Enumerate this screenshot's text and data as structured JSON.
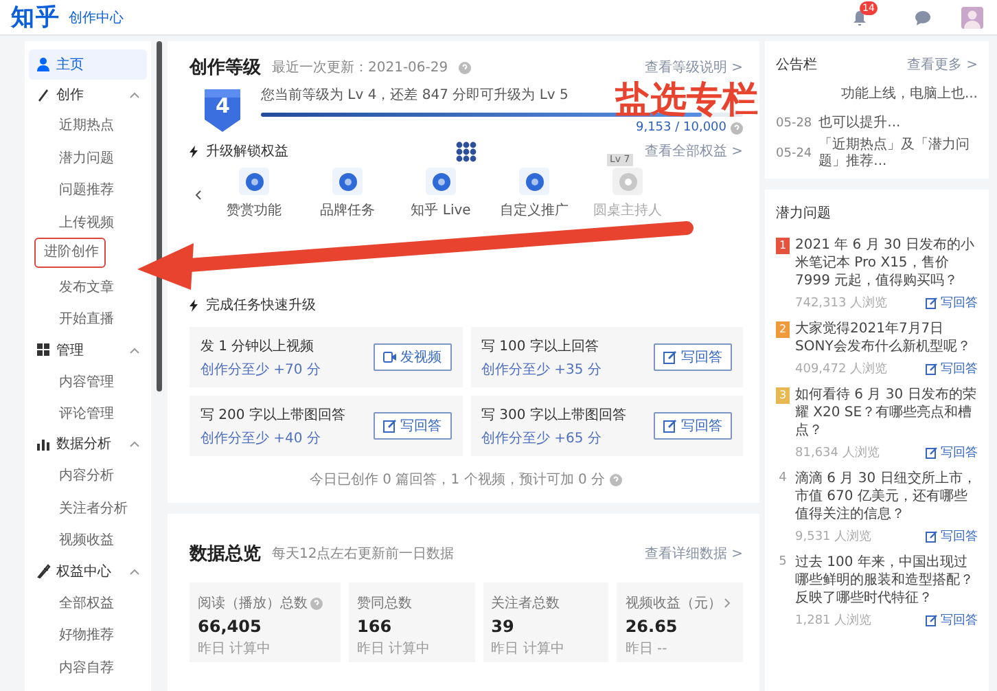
{
  "topbar": {
    "logo": "知乎",
    "subtitle": "创作中心",
    "notification_count": "14"
  },
  "sidebar": {
    "items": [
      {
        "label": "主页",
        "kind": "link",
        "selected": true
      },
      {
        "label": "创作",
        "kind": "section",
        "selected": false,
        "expanded": true,
        "children": [
          {
            "label": "近期热点",
            "selected": false,
            "circled": false
          },
          {
            "label": "潜力问题",
            "selected": false,
            "circled": false
          },
          {
            "label": "问题推荐",
            "selected": false,
            "circled": false
          },
          {
            "label": "上传视频",
            "selected": false,
            "circled": false
          },
          {
            "label": "进阶创作",
            "selected": false,
            "circled": true
          },
          {
            "label": "发布文章",
            "selected": false,
            "circled": false
          },
          {
            "label": "开始直播",
            "selected": false,
            "circled": false
          }
        ]
      },
      {
        "label": "管理",
        "kind": "section",
        "selected": false,
        "expanded": true,
        "children": [
          {
            "label": "内容管理",
            "selected": false,
            "circled": false
          },
          {
            "label": "评论管理",
            "selected": false,
            "circled": false
          }
        ]
      },
      {
        "label": "数据分析",
        "kind": "section",
        "selected": false,
        "expanded": true,
        "children": [
          {
            "label": "内容分析",
            "selected": false,
            "circled": false
          },
          {
            "label": "关注者分析",
            "selected": false,
            "circled": false
          },
          {
            "label": "视频收益",
            "selected": false,
            "circled": false
          }
        ]
      },
      {
        "label": "权益中心",
        "kind": "section",
        "selected": false,
        "expanded": true,
        "children": [
          {
            "label": "全部权益",
            "selected": false,
            "circled": false
          },
          {
            "label": "好物推荐",
            "selected": false,
            "circled": false
          },
          {
            "label": "内容自荐",
            "selected": false,
            "circled": false
          }
        ]
      }
    ]
  },
  "level_card": {
    "title": "创作等级",
    "updated": "最近一次更新：2021-06-29",
    "link": "查看等级说明 >",
    "badge": "4",
    "message": "您当前等级为 Lv 4，还差 847 分即可升级为 Lv 5",
    "level": 0.9153,
    "reading": "9,153 / 10,000",
    "benefits_title": "升级解锁权益",
    "benefits_link": "查看全部权益 >",
    "benefits": [
      {
        "label": "赞赏功能",
        "locked": false
      },
      {
        "label": "品牌任务",
        "locked": false
      },
      {
        "label": "知乎 Live",
        "locked": false
      },
      {
        "label": "自定义推广",
        "locked": false
      },
      {
        "label": "圆桌主持人",
        "locked": true,
        "tag": "Lv 7"
      }
    ],
    "tasks_title": "完成任务快速升级",
    "tasks": [
      {
        "title": "发 1 分钟以上视频",
        "reward": "创作分至少 +70 分",
        "action": "发视频",
        "kind": "video"
      },
      {
        "title": "写 100 字以上回答",
        "reward": "创作分至少 +35 分",
        "action": "写回答",
        "kind": "answer"
      },
      {
        "title": "写 200 字以上带图回答",
        "reward": "创作分至少 +40 分",
        "action": "写回答",
        "kind": "answer"
      },
      {
        "title": "写 300 字以上带图回答",
        "reward": "创作分至少 +65 分",
        "action": "写回答",
        "kind": "answer"
      }
    ],
    "summary": "今日已创作 0 篇回答，1 个视频，预计可加 0 分"
  },
  "data_card": {
    "title": "数据总览",
    "subtitle": "每天12点左右更新前一日数据",
    "link": "查看详细数据 >",
    "stats": [
      {
        "label": "阅读（播放）总数",
        "value": "66,405",
        "note": "昨日  计算中",
        "kind": "help"
      },
      {
        "label": "赞同总数",
        "value": "166",
        "note": "昨日  计算中",
        "kind": "plain"
      },
      {
        "label": "关注者总数",
        "value": "39",
        "note": "昨日  计算中",
        "kind": "plain"
      },
      {
        "label": "视频收益（元）",
        "value": "26.65",
        "note": "昨日  --",
        "kind": "link"
      }
    ]
  },
  "notice_board": {
    "title": "公告栏",
    "link": "查看更多 >",
    "items": [
      {
        "text": "功能上线，电脑上也..."
      },
      {
        "date": "05-28",
        "text": "也可以提升..."
      },
      {
        "date": "05-24",
        "text": "「近期热点」及「潜力问题」推荐..."
      }
    ]
  },
  "potential_questions": {
    "title": "潜力问题",
    "items": [
      {
        "rank": "1",
        "color": "#e5533f",
        "question": "2021 年 6 月 30 日发布的小米笔记本 Pro X15，售价 7999 元起，值得购买吗？",
        "views": "742,313 人浏览",
        "action": "写回答"
      },
      {
        "rank": "2",
        "color": "#f09a3c",
        "question": "大家觉得2021年7月7日SONY会发布什么新机型呢？",
        "views": "409,472 人浏览",
        "action": "写回答"
      },
      {
        "rank": "3",
        "color": "#e8b852",
        "question": "如何看待 6 月 30 日发布的荣耀 X20 SE？有哪些亮点和槽点？",
        "views": "81,634 人浏览",
        "action": "写回答"
      },
      {
        "rank": "4",
        "question": "滴滴 6 月 30 日纽交所上市，市值 670 亿美元，还有哪些值得关注的信息？",
        "views": "9,531 人浏览",
        "action": "写回答"
      },
      {
        "rank": "5",
        "question": "过去 100 年来，中国出现过哪些鲜明的服装和造型搭配？反映了哪些时代特征？",
        "views": "1,281 人浏览",
        "action": "写回答"
      }
    ]
  },
  "annotation": {
    "text": "盐选专栏"
  }
}
